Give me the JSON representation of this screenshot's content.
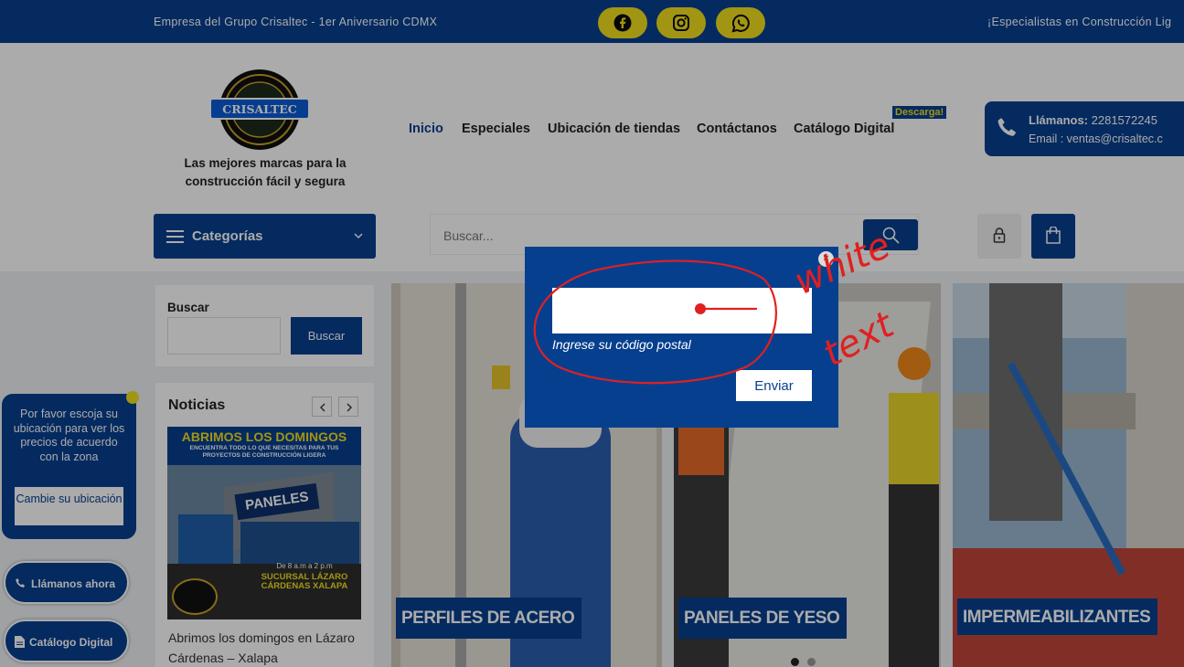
{
  "topbar": {
    "left_text": "Empresa del Grupo Crisaltec - 1er Aniversario CDMX",
    "right_text": "¡Especialistas en Construcción Lig",
    "social_icons": [
      "facebook-icon",
      "instagram-icon",
      "whatsapp-icon"
    ]
  },
  "brand": {
    "logo_text": "CRISALTEC",
    "tagline": "Las mejores marcas para la construcción fácil y segura"
  },
  "nav": {
    "items": [
      "Inicio",
      "Especiales",
      "Ubicación de tiendas",
      "Contáctanos",
      "Catálogo Digital"
    ],
    "active": "Inicio",
    "badge": "Descarga!"
  },
  "contact": {
    "phone_label": "Llámanos:",
    "phone": "2281572245",
    "email": "Email : ventas@crisaltec.c"
  },
  "categories_button": "Categorías",
  "search": {
    "placeholder": "Buscar..."
  },
  "sidebar": {
    "search_title": "Buscar",
    "search_button": "Buscar",
    "news_title": "Noticias",
    "news_image_heading": "ABRIMOS LOS DOMINGOS",
    "news_image_sub": "ENCUENTRA TODO LO QUE NECESITAS PARA TUS PROYECTOS DE CONSTRUCCIÓN LIGERA",
    "news_sign": "PANELES",
    "news_hours": "De 8 a.m a 2 p.m",
    "news_branch": "SUCURSAL LÁZARO CÁRDENAS XALAPA",
    "news_caption": "Abrimos los domingos en Lázaro Cárdenas – Xalapa"
  },
  "location_popup": {
    "text": "Por favor escoja su ubicación para ver los precios de acuerdo con la zona",
    "button": "Cambie su ubicación"
  },
  "floating": {
    "call": "Llámanos ahora",
    "catalog": "Catálogo Digital"
  },
  "panels": [
    "PERFILES DE ACERO",
    "PANELES DE YESO",
    "IMPERMEABILIZANTES"
  ],
  "modal": {
    "input_value": "",
    "label": "Ingrese su código postal",
    "submit": "Enviar",
    "close": "×"
  },
  "annotation": {
    "line1": "white",
    "line2": "text"
  },
  "colors": {
    "primary": "#073f8f",
    "accent": "#f2df1d",
    "annotation": "#e02020"
  }
}
